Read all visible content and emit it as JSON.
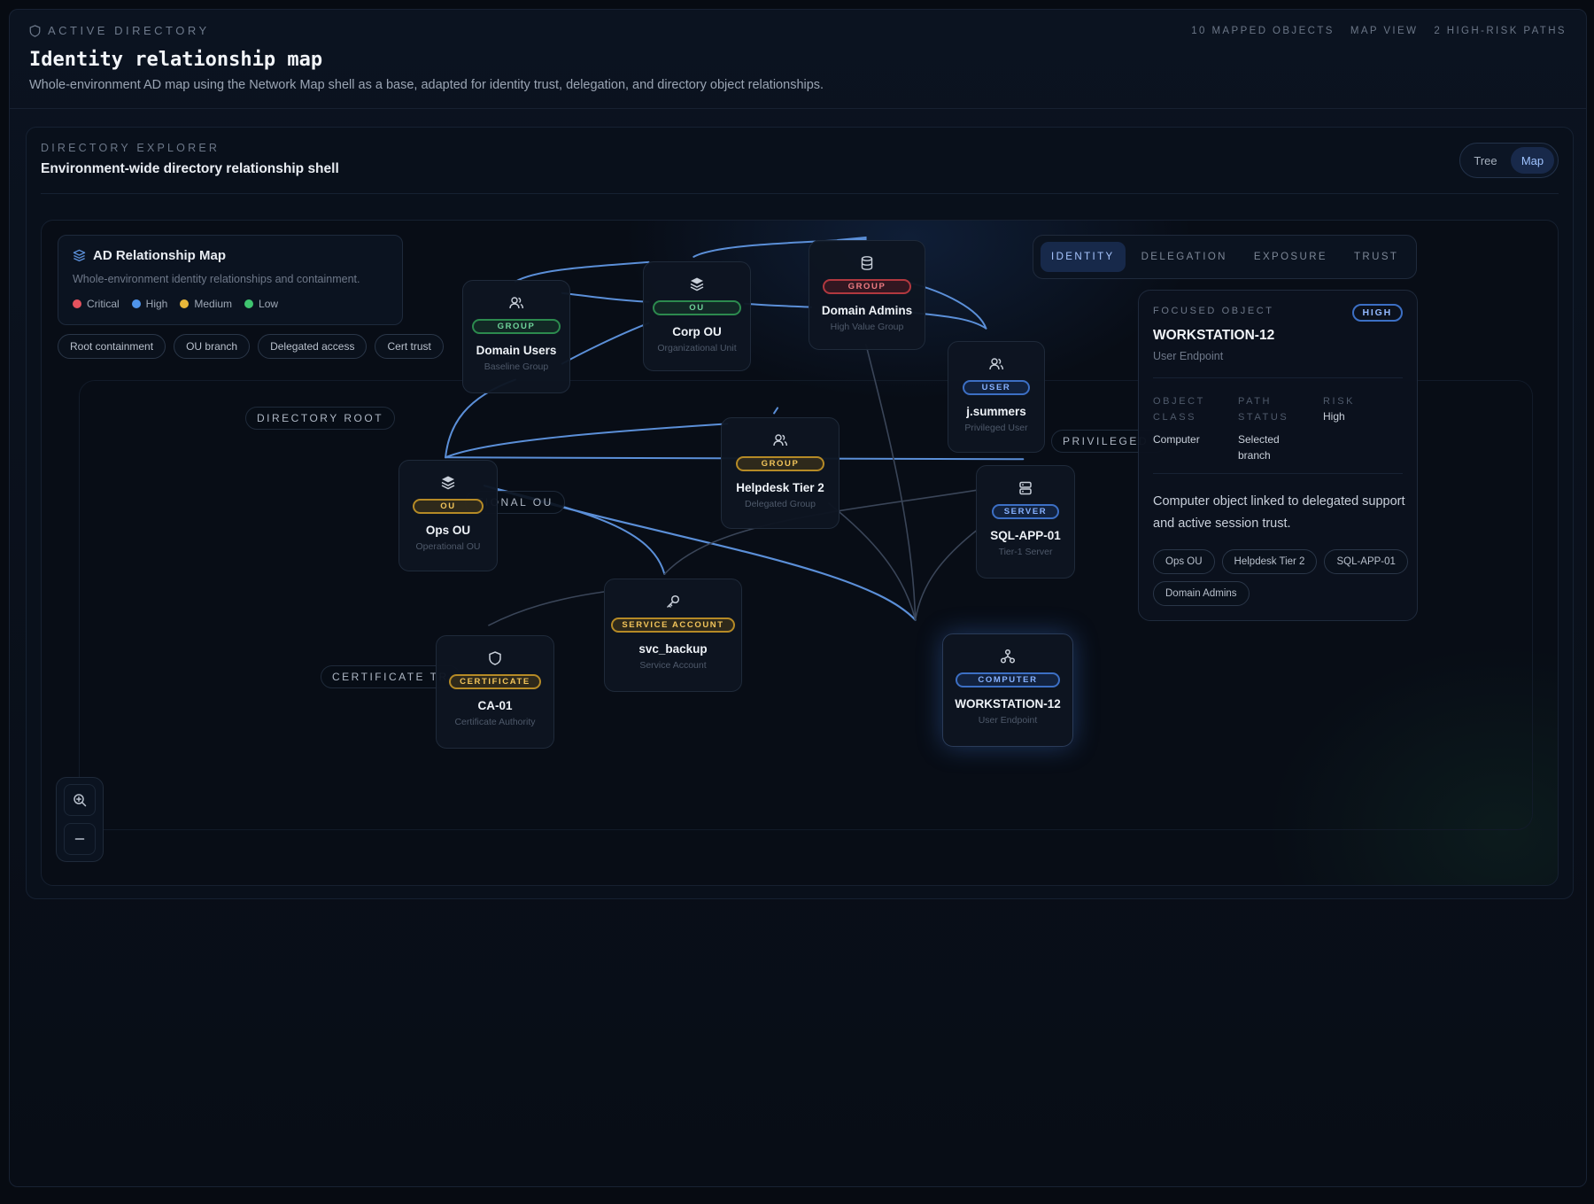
{
  "header": {
    "eyebrow": "ACTIVE DIRECTORY",
    "eyebrow_icon": "shield-icon",
    "title": "Identity relationship map",
    "subtitle": "Whole-environment AD map using the Network Map shell as a base, adapted for identity trust, delegation, and directory object relationships.",
    "meta": [
      "10 MAPPED OBJECTS",
      "MAP VIEW",
      "2 HIGH-RISK PATHS"
    ]
  },
  "panel": {
    "eyebrow": "DIRECTORY EXPLORER",
    "title": "Environment-wide directory relationship shell",
    "view_toggle": {
      "tree": "Tree",
      "map": "Map",
      "selected": "Map"
    }
  },
  "legend": {
    "icon": "layers-icon",
    "title": "AD Relationship Map",
    "description": "Whole-environment identity relationships and containment.",
    "keys": [
      {
        "label": "Critical",
        "color": "#e5525e"
      },
      {
        "label": "High",
        "color": "#4f94ea"
      },
      {
        "label": "Medium",
        "color": "#e8b73a"
      },
      {
        "label": "Low",
        "color": "#3fc46f"
      }
    ]
  },
  "filters": [
    "Root containment",
    "OU branch",
    "Delegated access",
    "Cert trust"
  ],
  "tags": {
    "directory_root": "DIRECTORY ROOT",
    "operational_ou": "TIONAL OU",
    "certificate_trust": "CERTIFICATE TR",
    "privileged": "PRIVILEGED"
  },
  "nodes": {
    "domain_users": {
      "badge": "GROUP",
      "name": "Domain Users",
      "type": "Baseline Group",
      "icon": "users-icon"
    },
    "corp_ou": {
      "badge": "OU",
      "name": "Corp OU",
      "type": "Organizational Unit",
      "icon": "layers-icon"
    },
    "domain_admins": {
      "badge": "GROUP",
      "name": "Domain Admins",
      "type": "High Value Group",
      "icon": "database-icon"
    },
    "jsummers": {
      "badge": "USER",
      "name": "j.summers",
      "type": "Privileged User",
      "icon": "users-icon"
    },
    "helpdesk": {
      "badge": "GROUP",
      "name": "Helpdesk Tier 2",
      "type": "Delegated Group",
      "icon": "users-icon"
    },
    "ops_ou": {
      "badge": "OU",
      "name": "Ops OU",
      "type": "Operational OU",
      "icon": "layers-icon"
    },
    "sql_app": {
      "badge": "SERVER",
      "name": "SQL-APP-01",
      "type": "Tier-1 Server",
      "icon": "server-icon"
    },
    "svc_backup": {
      "badge": "SERVICE ACCOUNT",
      "name": "svc_backup",
      "type": "Service Account",
      "icon": "key-icon"
    },
    "ca01": {
      "badge": "CERTIFICATE",
      "name": "CA-01",
      "type": "Certificate Authority",
      "icon": "shield-icon"
    },
    "workstation": {
      "badge": "COMPUTER",
      "name": "WORKSTATION-12",
      "type": "User Endpoint",
      "icon": "network-icon"
    }
  },
  "relation_tabs": {
    "items": [
      "IDENTITY",
      "DELEGATION",
      "EXPOSURE",
      "TRUST"
    ],
    "selected": "IDENTITY"
  },
  "focus": {
    "eyebrow": "FOCUSED OBJECT",
    "risk_badge": "HIGH",
    "title": "WORKSTATION-12",
    "subtitle": "User Endpoint",
    "object_class_label": "OBJECT CLASS",
    "object_class": "Computer",
    "path_status_label": "PATH STATUS",
    "path_status": "Selected branch",
    "risk_label": "RISK",
    "risk": "High",
    "description": "Computer object linked to delegated support and active session trust.",
    "related": [
      "Ops OU",
      "Helpdesk Tier 2",
      "SQL-APP-01",
      "Domain Admins"
    ]
  },
  "zoom": {
    "in_icon": "zoom-in-icon",
    "out_icon": "minus-icon"
  },
  "colors": {
    "edge": "#5b8fd8",
    "edge_dim": "#3a4558",
    "accent": "#9fc3ff"
  }
}
